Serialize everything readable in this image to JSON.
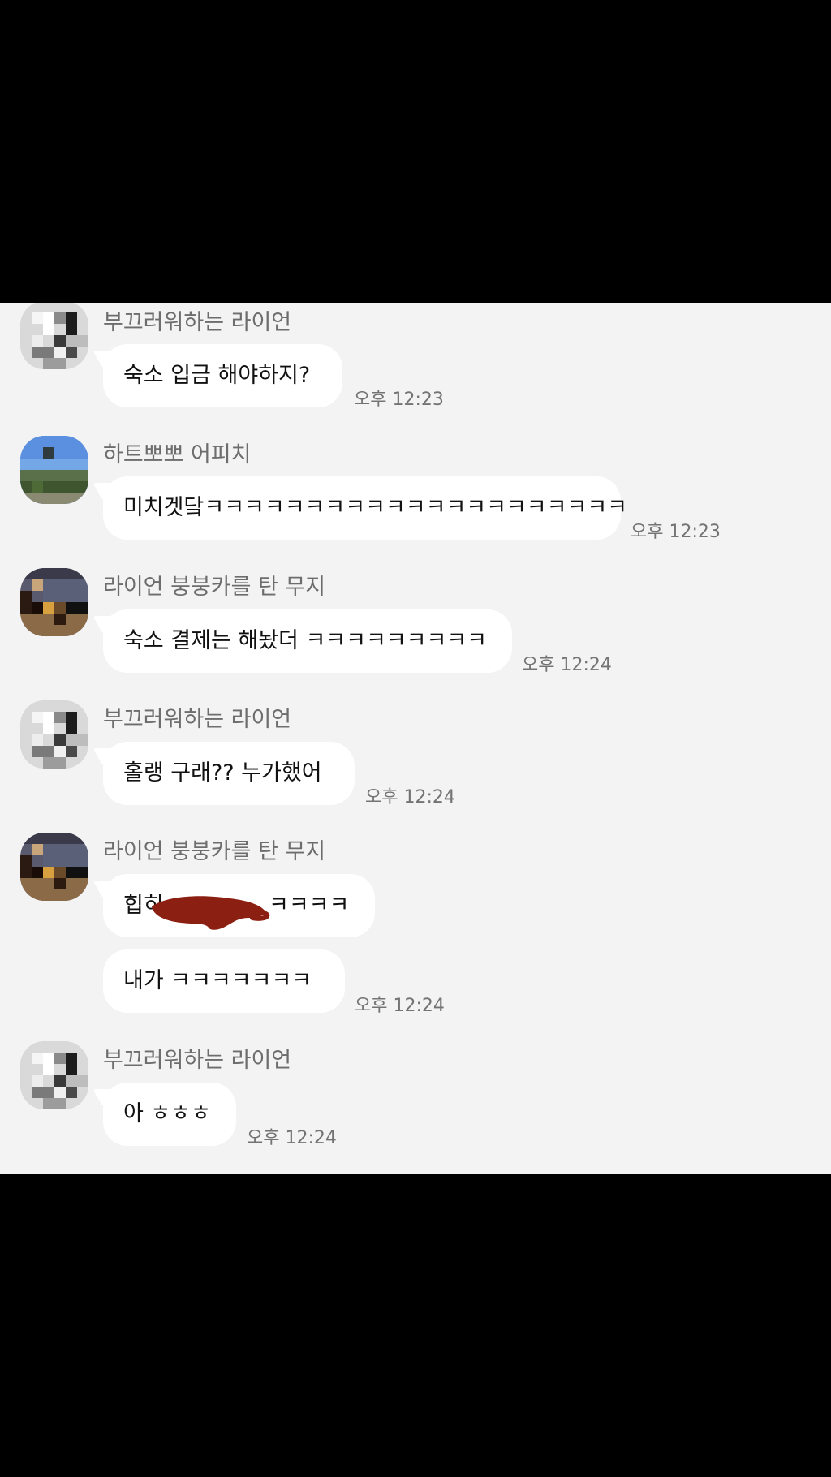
{
  "messages": [
    {
      "sender": "부끄러워하는 라이언",
      "bubbles": [
        "숙소 입금 해야하지?"
      ],
      "time": "오후 12:23"
    },
    {
      "sender": "하트뽀뽀 어피치",
      "bubbles": [
        "미치겟닼ㅋㅋㅋㅋㅋㅋㅋㅋㅋㅋㅋㅋㅋㅋㅋㅋㅋㅋㅋㅋㅋ"
      ],
      "time": "오후 12:23"
    },
    {
      "sender": "라이언 붕붕카를 탄 무지",
      "bubbles": [
        "숙소 결제는 해놨더 ㅋㅋㅋㅋㅋㅋㅋㅋㅋ"
      ],
      "time": "오후 12:24"
    },
    {
      "sender": "부끄러워하는 라이언",
      "bubbles": [
        "홀랭 구래?? 누가했어"
      ],
      "time": "오후 12:24"
    },
    {
      "sender": "라이언 붕붕카를 탄 무지",
      "bubbles": [
        "힙히",
        "ㅋㅋㅋㅋ",
        "내가 ㅋㅋㅋㅋㅋㅋㅋ"
      ],
      "time": "오후 12:24"
    },
    {
      "sender": "부끄러워하는 라이언",
      "bubbles": [
        "아 ㅎㅎㅎ"
      ],
      "time": "오후 12:24"
    }
  ],
  "colors": {
    "chat_background": "#f3f3f4",
    "bubble": "#ffffff",
    "redaction": "#8b1f12",
    "letterbox": "#000000"
  }
}
